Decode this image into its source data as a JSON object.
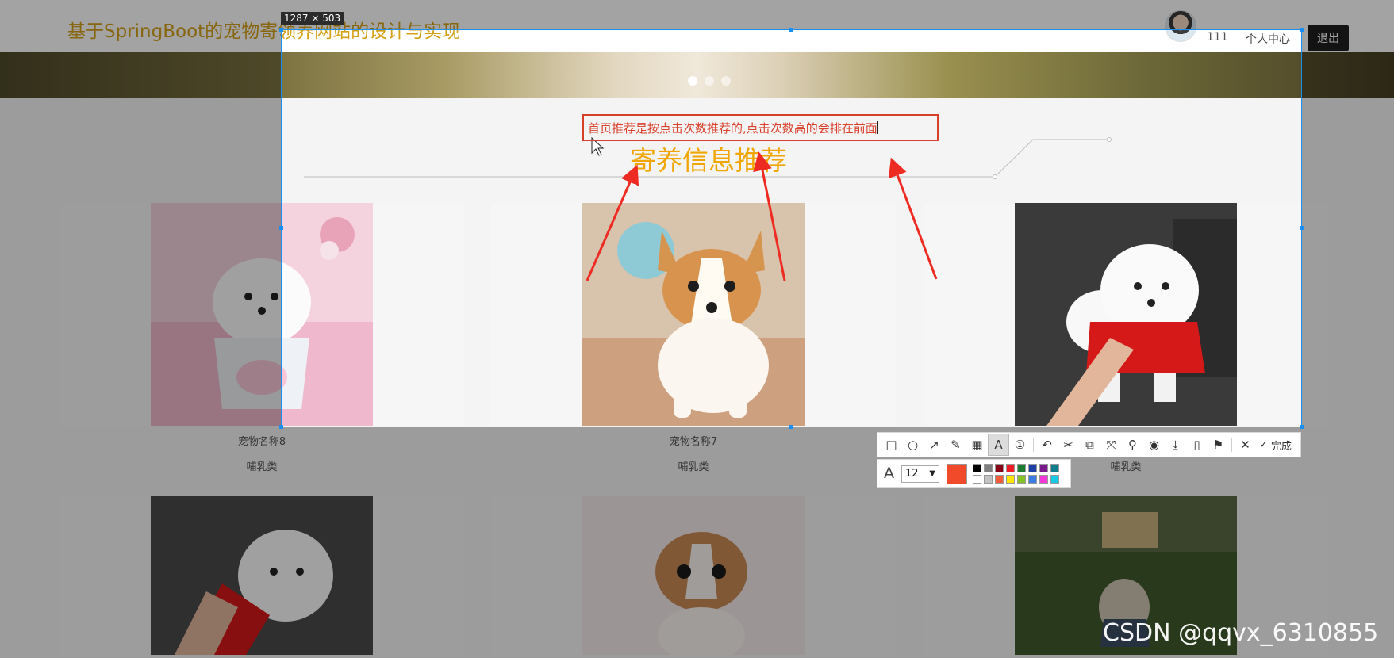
{
  "header": {
    "site_title": "基于SpringBoot的宠物寄领养网站的设计与实现",
    "username": "111",
    "user_center": "个人中心",
    "logout": "退出"
  },
  "banner": {
    "slides": 3,
    "active_slide": 1
  },
  "section": {
    "title": "寄养信息推荐"
  },
  "cards": [
    {
      "name": "宠物名称8",
      "category": "哺乳类"
    },
    {
      "name": "宠物名称7",
      "category": "哺乳类"
    },
    {
      "name": "",
      "category": "哺乳类"
    }
  ],
  "screenshot": {
    "size_label": "1287 × 503",
    "annotation_text": "首页推荐是按点击次数推荐的,点击次数高的会排在前面",
    "annotation_color": "#d8402a",
    "font_size": "12",
    "current_color": "#f04a2a",
    "palette": [
      "#000000",
      "#7f7f7f",
      "#880015",
      "#ed1c24",
      "#1e7d32",
      "#1f3fa8",
      "#7a1a8c",
      "#0f7d8c",
      "#ffffff",
      "#c3c3c3",
      "#f25d3a",
      "#ffe600",
      "#85c226",
      "#3b7de0",
      "#f238d6",
      "#17c9e3"
    ],
    "tools": [
      {
        "id": "rectangle",
        "icon": "rectangle-icon",
        "glyph": "□"
      },
      {
        "id": "ellipse",
        "icon": "ellipse-icon",
        "glyph": "○"
      },
      {
        "id": "arrow",
        "icon": "arrow-icon",
        "glyph": "↗"
      },
      {
        "id": "pen",
        "icon": "pen-icon",
        "glyph": "✎"
      },
      {
        "id": "mosaic",
        "icon": "mosaic-icon",
        "glyph": "▦"
      },
      {
        "id": "text",
        "icon": "text-icon",
        "glyph": "A"
      },
      {
        "id": "number",
        "icon": "number-icon",
        "glyph": "①"
      },
      {
        "id": "undo",
        "icon": "undo-icon",
        "glyph": "↶"
      },
      {
        "id": "cut",
        "icon": "cut-icon",
        "glyph": "✂"
      },
      {
        "id": "ocr",
        "icon": "ocr-icon",
        "glyph": "⧉"
      },
      {
        "id": "long-shot",
        "icon": "long-shot-icon",
        "glyph": "⤧"
      },
      {
        "id": "pin",
        "icon": "pin-icon",
        "glyph": "⚲"
      },
      {
        "id": "record",
        "icon": "record-icon",
        "glyph": "◉"
      },
      {
        "id": "download",
        "icon": "download-icon",
        "glyph": "⤓"
      },
      {
        "id": "save",
        "icon": "save-icon",
        "glyph": "▯"
      },
      {
        "id": "bookmark",
        "icon": "bookmark-icon",
        "glyph": "⚑"
      }
    ],
    "active_tool": "text",
    "close_glyph": "✕",
    "done_glyph": "✓",
    "done_label": "完成"
  },
  "watermark": "CSDN @qqvx_6310855"
}
